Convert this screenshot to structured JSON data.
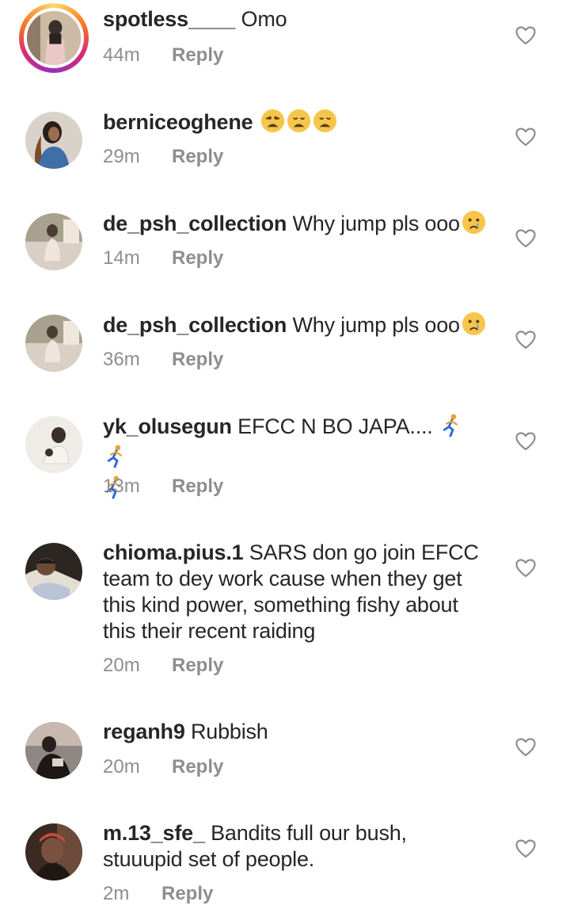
{
  "comments": [
    {
      "username": "spotless____",
      "text": "Omo",
      "time": "44m",
      "reply_label": "Reply",
      "emojis": [],
      "avatar_colors": [
        "#c9b9a8",
        "#3a2f2a",
        "#e8c9c6"
      ]
    },
    {
      "username": "berniceoghene",
      "text": "",
      "time": "29m",
      "reply_label": "Reply",
      "emojis": [
        "weary-face",
        "weary-face",
        "weary-face"
      ],
      "avatar_colors": [
        "#6f8fb6",
        "#2b1e18",
        "#9a6e4c"
      ]
    },
    {
      "username": "de_psh_collection",
      "text": "Why jump pls ooo",
      "time": "14m",
      "reply_label": "Reply",
      "emojis": [
        "crying-face"
      ],
      "avatar_colors": [
        "#d9cfc4",
        "#4a3c33",
        "#efe6dc"
      ]
    },
    {
      "username": "de_psh_collection",
      "text": "Why jump pls ooo",
      "time": "36m",
      "reply_label": "Reply",
      "emojis": [
        "crying-face"
      ],
      "avatar_colors": [
        "#d9cfc4",
        "#4a3c33",
        "#efe6dc"
      ]
    },
    {
      "username": "yk_olusegun",
      "text": "EFCC N BO JAPA....",
      "time": "13m",
      "reply_label": "Reply",
      "emojis": [
        "running-man",
        "running-man",
        "running-man"
      ],
      "avatar_colors": [
        "#e8e4de",
        "#3b2f29",
        "#f4f1ec"
      ]
    },
    {
      "username": "chioma.pius.1",
      "text": "SARS don go join EFCC team to dey work cause when they get this kind power, something fishy about this their recent raiding",
      "time": "20m",
      "reply_label": "Reply",
      "emojis": [],
      "avatar_colors": [
        "#b8c4d6",
        "#1f1a17",
        "#e4ddd4"
      ]
    },
    {
      "username": "reganh9",
      "text": "Rubbish",
      "time": "20m",
      "reply_label": "Reply",
      "emojis": [],
      "avatar_colors": [
        "#a09a96",
        "#2a1f1c",
        "#c7b8b0"
      ]
    },
    {
      "username": "m.13_sfe_",
      "text": "Bandits full our bush, stuuupid set of people.",
      "time": "2m",
      "reply_label": "Reply",
      "emojis": [],
      "avatar_colors": [
        "#c74a3b",
        "#2a1d17",
        "#7a5240"
      ]
    }
  ],
  "colors": {
    "text": "#262626",
    "meta": "#8e8e8e",
    "story_ring_start": "#feda75",
    "story_ring_end": "#d62976"
  },
  "icons": {
    "like": "heart-outline-icon"
  }
}
